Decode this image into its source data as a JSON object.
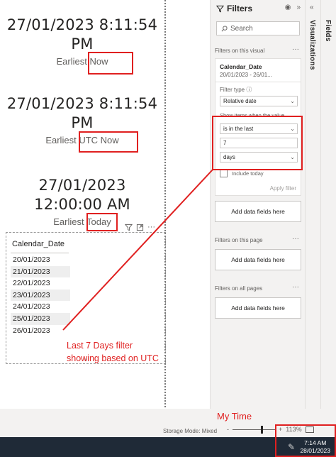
{
  "cards": [
    {
      "value_line1": "27/01/2023 8:11:54",
      "value_line2": "PM",
      "caption_prefix": "Earliest",
      "caption_field": "Now"
    },
    {
      "value_line1": "27/01/2023 8:11:54",
      "value_line2": "PM",
      "caption_prefix": "Earliest",
      "caption_field": "UTC Now"
    },
    {
      "value_line1": "27/01/2023",
      "value_line2": "12:00:00 AM",
      "caption_prefix": "Earliest",
      "caption_field": "Today"
    }
  ],
  "visual_header_icons": [
    "filter-icon",
    "focus-mode-icon",
    "more-options-icon"
  ],
  "table": {
    "header": "Calendar_Date",
    "rows": [
      "20/01/2023",
      "21/01/2023",
      "22/01/2023",
      "23/01/2023",
      "24/01/2023",
      "25/01/2023",
      "26/01/2023"
    ]
  },
  "filters_pane": {
    "title": "Filters",
    "search_placeholder": "Search",
    "section_visual": "Filters on this visual",
    "filter_card": {
      "field": "Calendar_Date",
      "value": "20/01/2023 - 26/01...",
      "filter_type_label": "Filter type",
      "filter_type": "Relative date",
      "show_items_label": "Show items when the value",
      "condition": "is in the last",
      "amount": "7",
      "unit": "days",
      "include_today": "Include today",
      "apply": "Apply filter"
    },
    "add_fields": "Add data fields here",
    "section_page": "Filters on this page",
    "section_all": "Filters on all pages"
  },
  "side_panes": {
    "visualizations": "Visualizations",
    "fields": "Fields"
  },
  "status": {
    "storage_mode": "Storage Mode: Mixed",
    "zoom_out": "-",
    "zoom_in": "+",
    "zoom_level": "113%"
  },
  "taskbar": {
    "time": "7:14 AM",
    "date": "28/01/2023"
  },
  "annotations": {
    "note_line1": "Last 7 Days filter",
    "note_line2": "showing based on UTC",
    "my_time": "My Time",
    "color": "#e02020"
  }
}
